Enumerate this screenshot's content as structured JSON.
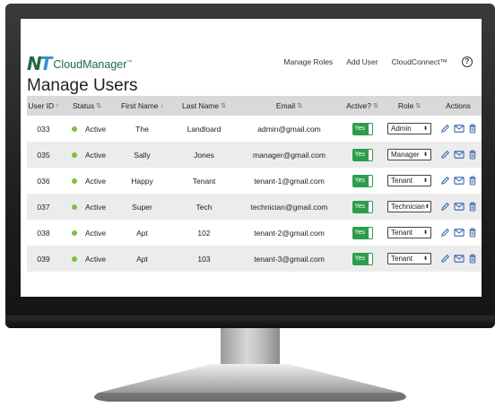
{
  "brand": {
    "logo_n": "N",
    "logo_t": "T",
    "name": "CloudManager",
    "tm": "™"
  },
  "nav": {
    "items": [
      "Manage Roles",
      "Add User",
      "CloudConnect™"
    ],
    "help": "?"
  },
  "page": {
    "title": "Manage Users"
  },
  "table": {
    "headers": {
      "user_id": "User ID",
      "user_id_sort": "↑",
      "status": "Status",
      "status_sort": "⇅",
      "first": "First Name",
      "first_sort": "↓",
      "last": "Last Name",
      "last_sort": "⇅",
      "email": "Email",
      "email_sort": "⇅",
      "active": "Active?",
      "active_sort": "⇅",
      "role": "Role",
      "role_sort": "⇅",
      "actions": "Actions"
    },
    "rows": [
      {
        "id": "033",
        "status": "Active",
        "first": "The",
        "last": "Landloard",
        "email": "admin@gmail.com",
        "active": "Yes",
        "role": "Admin"
      },
      {
        "id": "035",
        "status": "Active",
        "first": "Sally",
        "last": "Jones",
        "email": "manager@gmail.com",
        "active": "Yes",
        "role": "Manager"
      },
      {
        "id": "036",
        "status": "Active",
        "first": "Happy",
        "last": "Tenant",
        "email": "tenant-1@gmail.com",
        "active": "Yes",
        "role": "Tenant"
      },
      {
        "id": "037",
        "status": "Active",
        "first": "Super",
        "last": "Tech",
        "email": "technician@gmail.com",
        "active": "Yes",
        "role": "Technician"
      },
      {
        "id": "038",
        "status": "Active",
        "first": "Apt",
        "last": "102",
        "email": "tenant-2@gmail.com",
        "active": "Yes",
        "role": "Tenant"
      },
      {
        "id": "039",
        "status": "Active",
        "first": "Apt",
        "last": "103",
        "email": "tenant-3@gmail.com",
        "active": "Yes",
        "role": "Tenant"
      }
    ],
    "select_arrow": "⬍"
  },
  "colors": {
    "brand_green": "#1e6b3f",
    "brand_blue": "#3a8fd6",
    "active_dot": "#7bc043",
    "toggle_green": "#2e9d4b",
    "action_blue": "#2f5ea8"
  },
  "icons": {
    "edit": "pencil-icon",
    "email": "envelope-icon",
    "delete": "trash-icon"
  }
}
